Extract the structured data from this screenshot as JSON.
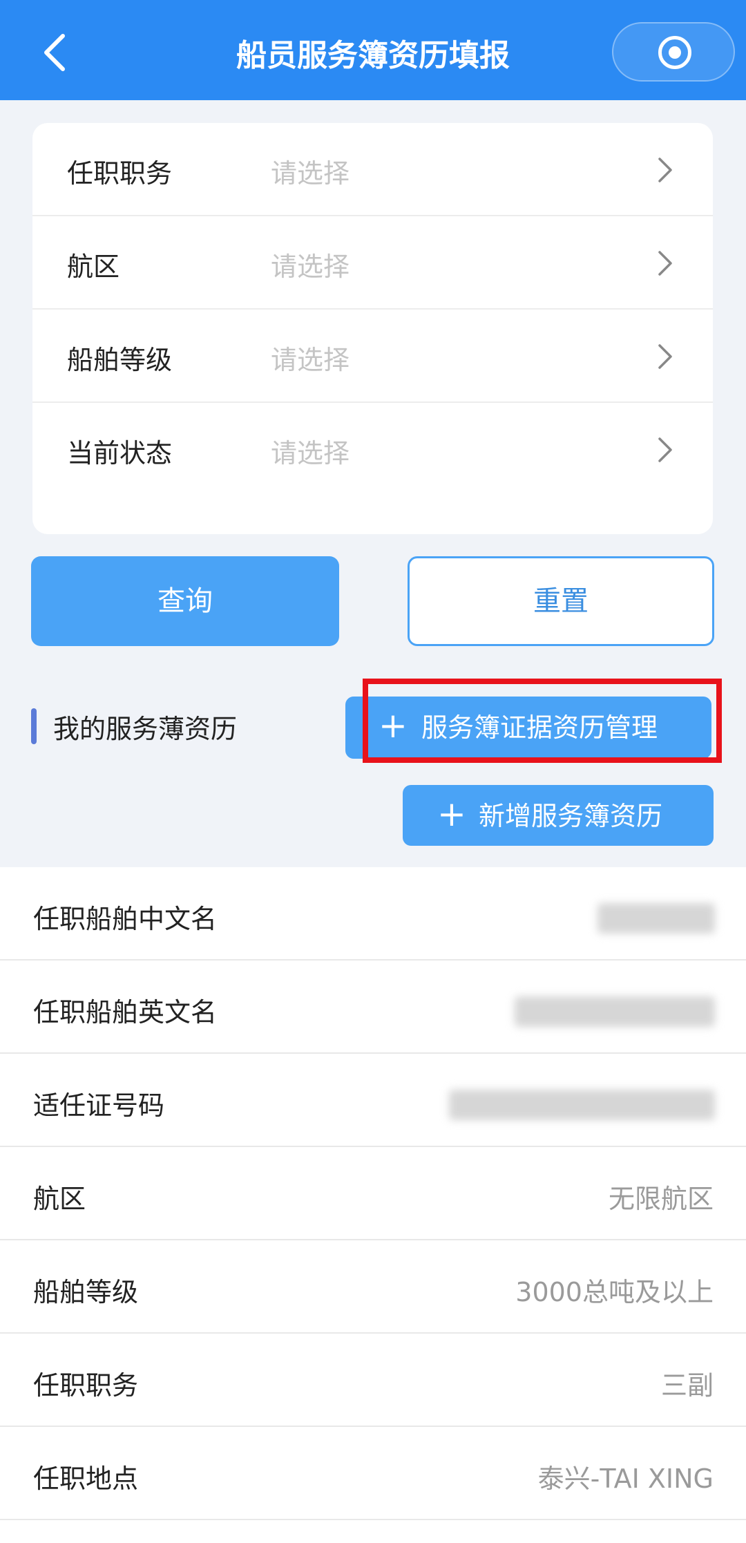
{
  "header": {
    "title": "船员服务簿资历填报"
  },
  "filters": [
    {
      "label": "任职职务",
      "placeholder": "请选择"
    },
    {
      "label": "航区",
      "placeholder": "请选择"
    },
    {
      "label": "船舶等级",
      "placeholder": "请选择"
    },
    {
      "label": "当前状态",
      "placeholder": "请选择"
    }
  ],
  "buttons": {
    "query": "查询",
    "reset": "重置",
    "cert_manage": "服务簿证据资历管理",
    "add_record": "新增服务簿资历"
  },
  "section": {
    "title": "我的服务薄资历"
  },
  "details": [
    {
      "label": "任职船舶中文名",
      "value": ""
    },
    {
      "label": "任职船舶英文名",
      "value": ""
    },
    {
      "label": "适任证号码",
      "value": ""
    },
    {
      "label": "航区",
      "value": "无限航区"
    },
    {
      "label": "船舶等级",
      "value": "3000总吨及以上"
    },
    {
      "label": "任职职务",
      "value": "三副"
    },
    {
      "label": "任职地点",
      "value": "泰兴-TAI XING"
    }
  ],
  "colors": {
    "header_bg": "#2b8af3",
    "button_primary": "#4aa3f6",
    "highlight": "#e8121b"
  }
}
